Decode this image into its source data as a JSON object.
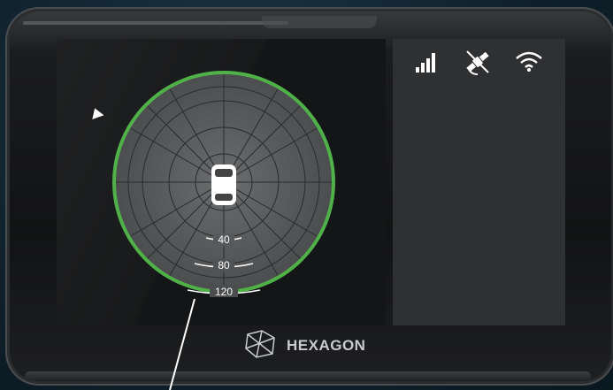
{
  "device": {
    "brand": "HEXAGON",
    "accent_color": "#4fb148",
    "screen_bg": "#141516",
    "panel_bg": "#2f3032"
  },
  "radar": {
    "range_labels": [
      "40",
      "80",
      "120"
    ],
    "vehicle_icon": "vehicle-top-view-icon",
    "heading_icon": "heading-arrow-icon"
  },
  "status_bar": {
    "icons": [
      "signal-strength-icon",
      "satellite-icon",
      "wifi-icon"
    ]
  }
}
